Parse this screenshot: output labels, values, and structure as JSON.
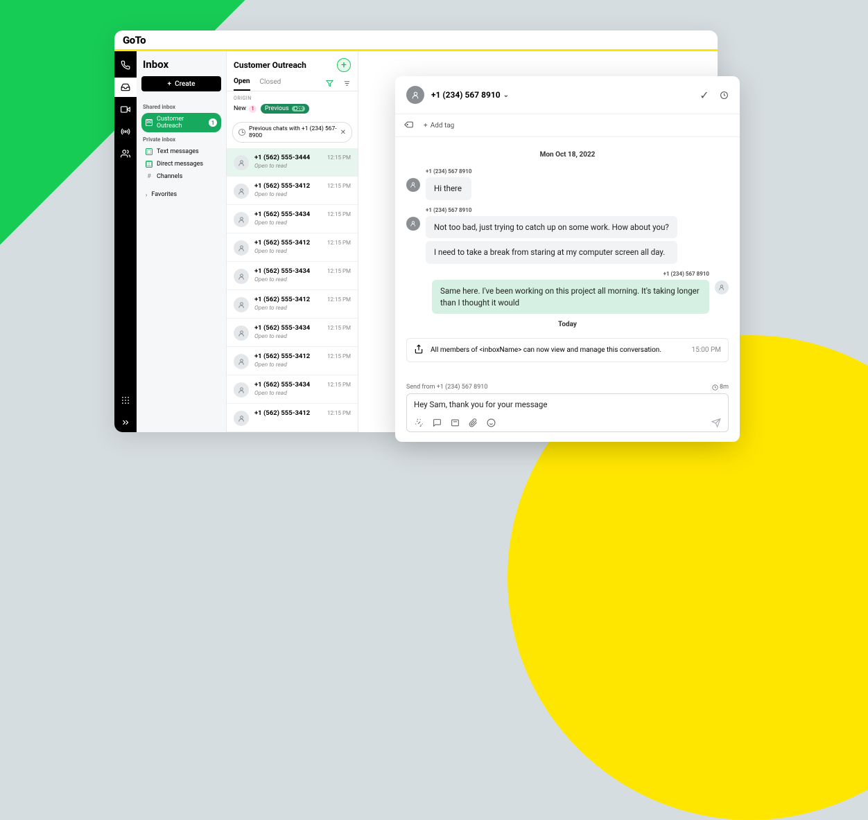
{
  "brand": "GoTo",
  "sidebar": {
    "title": "Inbox",
    "create_label": "Create",
    "shared_label": "Shared inbox",
    "shared_folders": [
      {
        "name": "Customer Outreach",
        "badge": "1",
        "selected": true
      }
    ],
    "private_label": "Private inbox",
    "private_folders": [
      {
        "name": "Text messages",
        "icon": "box"
      },
      {
        "name": "Direct messages",
        "icon": "box"
      },
      {
        "name": "Channels",
        "icon": "hash"
      }
    ],
    "favorites_label": "Favorites"
  },
  "convpane": {
    "title": "Customer Outreach",
    "tabs": {
      "open": "Open",
      "closed": "Closed"
    },
    "origin_label": "ORIGIN",
    "pill_new": "New",
    "pill_new_count": "1",
    "pill_prev": "Previous",
    "pill_prev_count": "+20",
    "context_chip": "Previous chats with +1 (234) 567-8900",
    "items": [
      {
        "phone": "+1 (562) 555-3444",
        "time": "12:15 PM",
        "sub": "Open to read",
        "selected": true
      },
      {
        "phone": "+1 (562) 555-3412",
        "time": "12:15 PM",
        "sub": "Open to read"
      },
      {
        "phone": "+1 (562) 555-3434",
        "time": "12:15 PM",
        "sub": "Open to read"
      },
      {
        "phone": "+1 (562) 555-3412",
        "time": "12:15 PM",
        "sub": "Open to read"
      },
      {
        "phone": "+1 (562) 555-3434",
        "time": "12:15 PM",
        "sub": "Open to read"
      },
      {
        "phone": "+1 (562) 555-3412",
        "time": "12:15 PM",
        "sub": "Open to read"
      },
      {
        "phone": "+1 (562) 555-3434",
        "time": "12:15 PM",
        "sub": "Open to read"
      },
      {
        "phone": "+1 (562) 555-3412",
        "time": "12:15 PM",
        "sub": "Open to read"
      },
      {
        "phone": "+1 (562) 555-3434",
        "time": "12:15 PM",
        "sub": "Open to read"
      },
      {
        "phone": "+1 (562) 555-3412",
        "time": "12:15 PM",
        "sub": ""
      }
    ]
  },
  "chat": {
    "header_phone": "+1 (234) 567 8910",
    "add_tag_label": "Add tag",
    "date1": "Mon Oct 18, 2022",
    "sender_a": "+1 (234) 567 8910",
    "m1": "Hi there",
    "m2": "Not too bad, just trying to catch up on some work. How about you?",
    "m3": "I need to take a break from staring at my computer screen all day.",
    "sender_b": "+1 (234) 567 8910",
    "m4": "Same here. I've been working on this project all morning. It's taking longer than I thought it would",
    "date2": "Today",
    "system_msg": "All members of <inboxName> can now view and manage this conversation.",
    "system_time": "15:00 PM",
    "send_from_label": "Send from +1 (234) 567 8910",
    "countdown": "8m",
    "draft": "Hey Sam, thank you for your message"
  }
}
